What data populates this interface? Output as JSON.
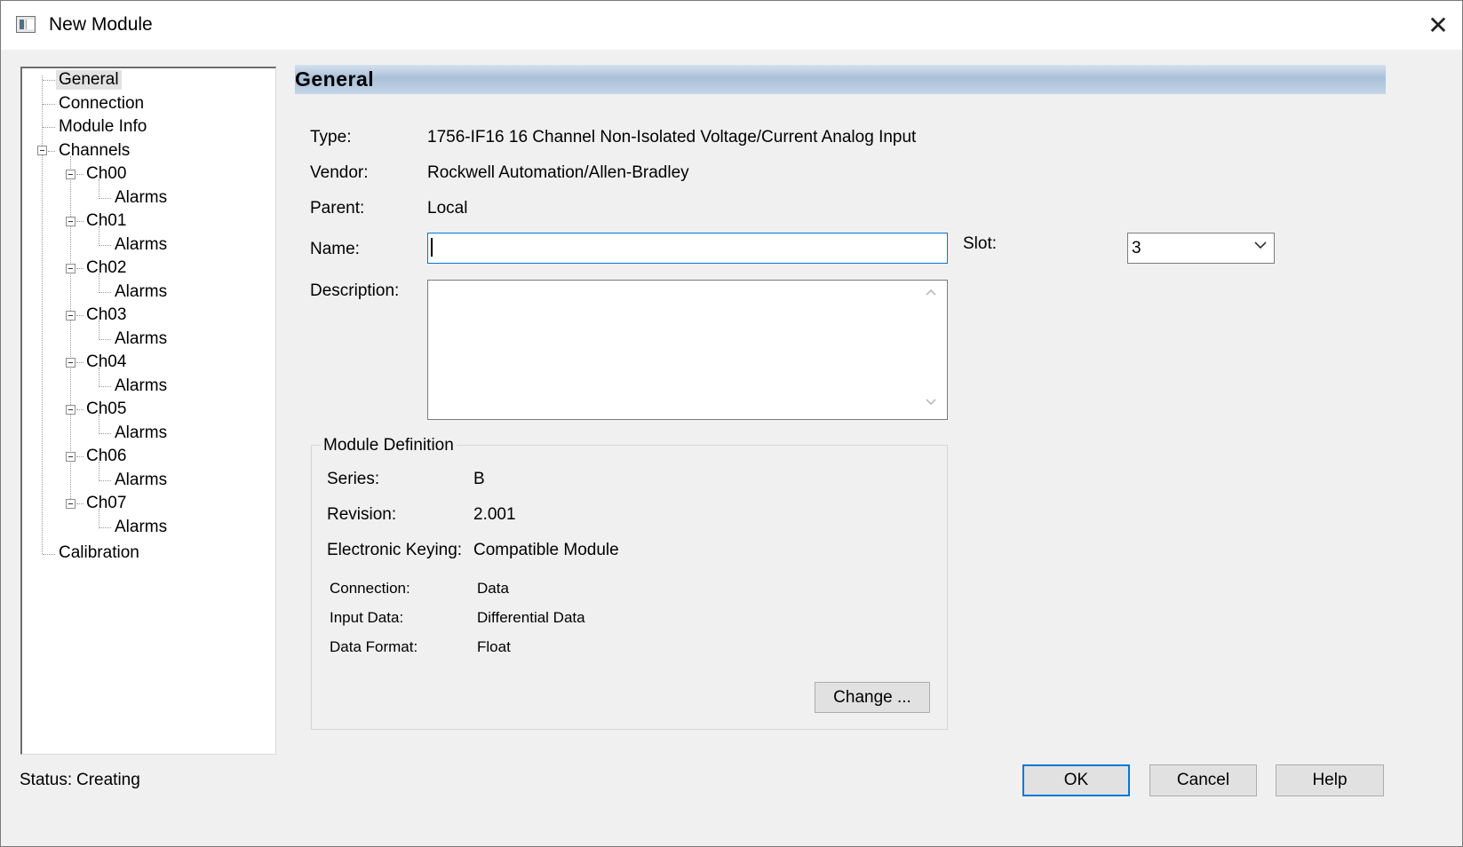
{
  "window": {
    "title": "New Module",
    "close_glyph": "✕",
    "app_icon": "module-window-icon"
  },
  "tree": {
    "general": "General",
    "connection": "Connection",
    "module_info": "Module Info",
    "channels": "Channels",
    "channel_items": [
      {
        "label": "Ch00",
        "child": "Alarms"
      },
      {
        "label": "Ch01",
        "child": "Alarms"
      },
      {
        "label": "Ch02",
        "child": "Alarms"
      },
      {
        "label": "Ch03",
        "child": "Alarms"
      },
      {
        "label": "Ch04",
        "child": "Alarms"
      },
      {
        "label": "Ch05",
        "child": "Alarms"
      },
      {
        "label": "Ch06",
        "child": "Alarms"
      },
      {
        "label": "Ch07",
        "child": "Alarms"
      }
    ],
    "calibration": "Calibration"
  },
  "general": {
    "header": "General",
    "type_label": "Type:",
    "type_value": "1756-IF16 16 Channel Non-Isolated Voltage/Current Analog Input",
    "vendor_label": "Vendor:",
    "vendor_value": "Rockwell Automation/Allen-Bradley",
    "parent_label": "Parent:",
    "parent_value": "Local",
    "name_label": "Name:",
    "name_value": "",
    "slot_label": "Slot:",
    "slot_value": "3",
    "description_label": "Description:",
    "description_value": ""
  },
  "module_definition": {
    "title": "Module Definition",
    "series_label": "Series:",
    "series_value": "B",
    "revision_label": "Revision:",
    "revision_value": "2.001",
    "keying_label": "Electronic Keying:",
    "keying_value": "Compatible Module",
    "connection_label": "Connection:",
    "connection_value": "Data",
    "input_data_label": "Input Data:",
    "input_data_value": "Differential Data",
    "data_format_label": "Data Format:",
    "data_format_value": "Float",
    "change_button": "Change ..."
  },
  "footer": {
    "status_label": "Status:",
    "status_value": "Creating",
    "ok": "OK",
    "cancel": "Cancel",
    "help": "Help"
  },
  "colors": {
    "accent": "#0078d7",
    "header_band": "#a9c0d8",
    "dialog_bg": "#f0f0f0"
  }
}
